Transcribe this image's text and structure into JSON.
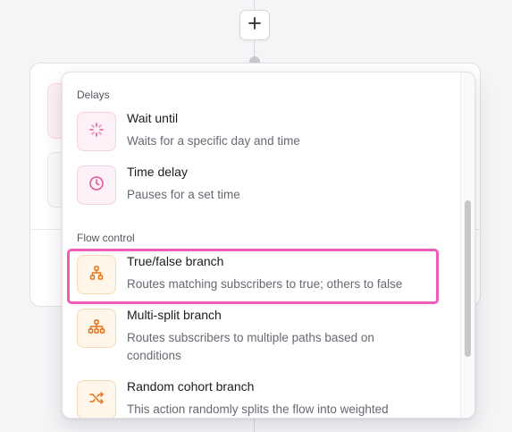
{
  "canvas": {
    "add_button_label": "+"
  },
  "menu": {
    "sections": [
      {
        "label": "Delays",
        "items": [
          {
            "title": "Wait until",
            "description": "Waits for a specific day and time",
            "icon": "loading-spinner-icon"
          },
          {
            "title": "Time delay",
            "description": "Pauses for a set time",
            "icon": "clock-icon"
          }
        ]
      },
      {
        "label": "Flow control",
        "items": [
          {
            "title": "True/false branch",
            "description": "Routes matching subscribers to true; others to false",
            "icon": "branch-split-icon",
            "highlighted": true
          },
          {
            "title": "Multi-split branch",
            "description": "Routes subscribers to multiple paths based on conditions",
            "icon": "multi-branch-icon"
          },
          {
            "title": "Random cohort branch",
            "description": "This action randomly splits the flow into weighted",
            "icon": "shuffle-icon"
          }
        ]
      }
    ]
  },
  "colors": {
    "delay_icon": "#e0559b",
    "flow_icon": "#e8711a",
    "highlight_outline": "#ef5bb9"
  }
}
